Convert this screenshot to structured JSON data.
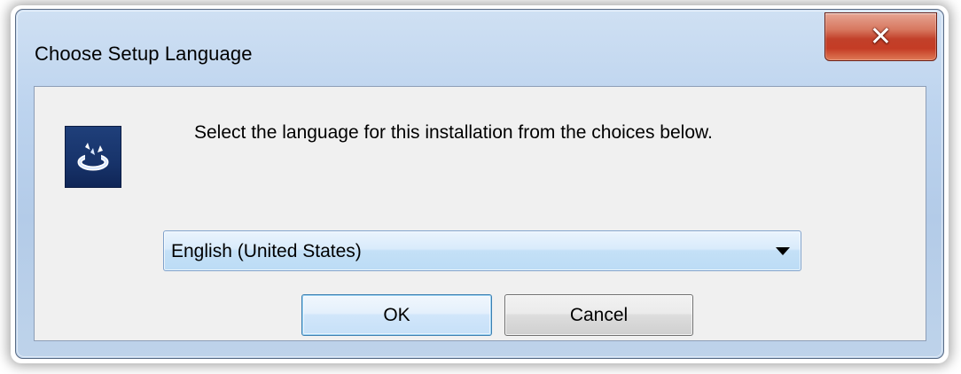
{
  "window": {
    "title": "Choose Setup Language",
    "close_icon": "close-icon"
  },
  "dialog": {
    "app_icon": "installer-icon",
    "message": "Select the language for this installation from the choices below.",
    "language_select": {
      "selected": "English (United States)",
      "dropdown_icon": "chevron-down-icon"
    },
    "ok_label": "OK",
    "cancel_label": "Cancel"
  },
  "colors": {
    "title_bar": "#bcd3ee",
    "close_button": "#c43c25",
    "client_bg": "#f0f0f0",
    "app_icon_bg": "#17336a",
    "default_button_border": "#3c7fb1"
  }
}
